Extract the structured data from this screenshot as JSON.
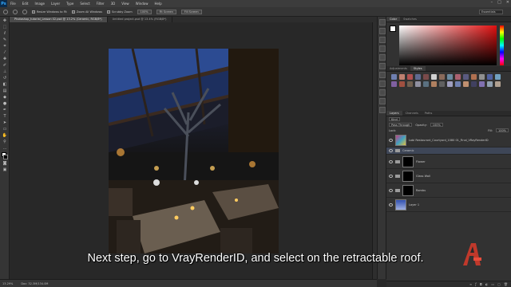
{
  "app": {
    "logo": "Ps"
  },
  "menu": [
    "File",
    "Edit",
    "Image",
    "Layer",
    "Type",
    "Select",
    "Filter",
    "3D",
    "View",
    "Window",
    "Help"
  ],
  "window_controls": [
    "–",
    "□",
    "✕"
  ],
  "options_bar": {
    "resize_windows_label": "Resize Windows to Fit",
    "zoom_all_label": "Zoom All Windows",
    "scrubby_zoom_label": "Scrubby Zoom",
    "btn_100": "100%",
    "btn_fit": "Fit Screen",
    "btn_fill": "Fill Screen",
    "workspace": "Essentials"
  },
  "tabs": [
    {
      "label": "Photoshop_tutorial_Lesson 02.psd @ 13.2% (Ceramic, RGB/8*)",
      "active": true
    },
    {
      "label": "Untitled project.psd @ 13.4% (RGB/8*)",
      "active": false
    }
  ],
  "status": {
    "zoom": "13.29%",
    "doc": "Doc: 32.3M/134.0M"
  },
  "color_panel": {
    "tabs": [
      "Color",
      "Swatches"
    ]
  },
  "styles_panel": {
    "tabs": [
      "Adjustments",
      "Styles"
    ]
  },
  "swatches": [
    "#6f7fb0",
    "#c08070",
    "#b05050",
    "#606a90",
    "#7a4a4a",
    "#d0d0d0",
    "#8a6a5a",
    "#6a8aa0",
    "#aa6070",
    "#5a5a80",
    "#b07050",
    "#909090",
    "#5060a0",
    "#70a0c0",
    "#8060a0",
    "#a05040",
    "#706050",
    "#9090a0",
    "#5a7080",
    "#b08060",
    "#606060",
    "#a0a0c0",
    "#7080b0",
    "#c09070",
    "#404060",
    "#8070b0",
    "#90a0b0",
    "#b0a090"
  ],
  "layers_panel": {
    "tabs": [
      "Layers",
      "Channels",
      "Paths"
    ],
    "kind_label": "Kind",
    "blend_mode": "Pass Through",
    "opacity_label": "Opacity:",
    "opacity": "100%",
    "lock_label": "Lock:",
    "fill_label": "Fill:",
    "fill": "100%",
    "layers": [
      {
        "name": "Lobi Restaurant_Courtyard_1080 01_Final_VRayRenderID",
        "type": "image",
        "selected": false
      },
      {
        "name": "Ceramic",
        "type": "group-open",
        "selected": true
      },
      {
        "name": "Flower",
        "type": "group-mask",
        "selected": false
      },
      {
        "name": "Glass Wall",
        "type": "group-mask",
        "selected": false
      },
      {
        "name": "Rambu",
        "type": "group-mask",
        "selected": false
      },
      {
        "name": "Layer 1",
        "type": "image",
        "selected": false
      }
    ]
  },
  "subtitle": "Next step, go to VrayRenderID, and select on the retractable roof."
}
